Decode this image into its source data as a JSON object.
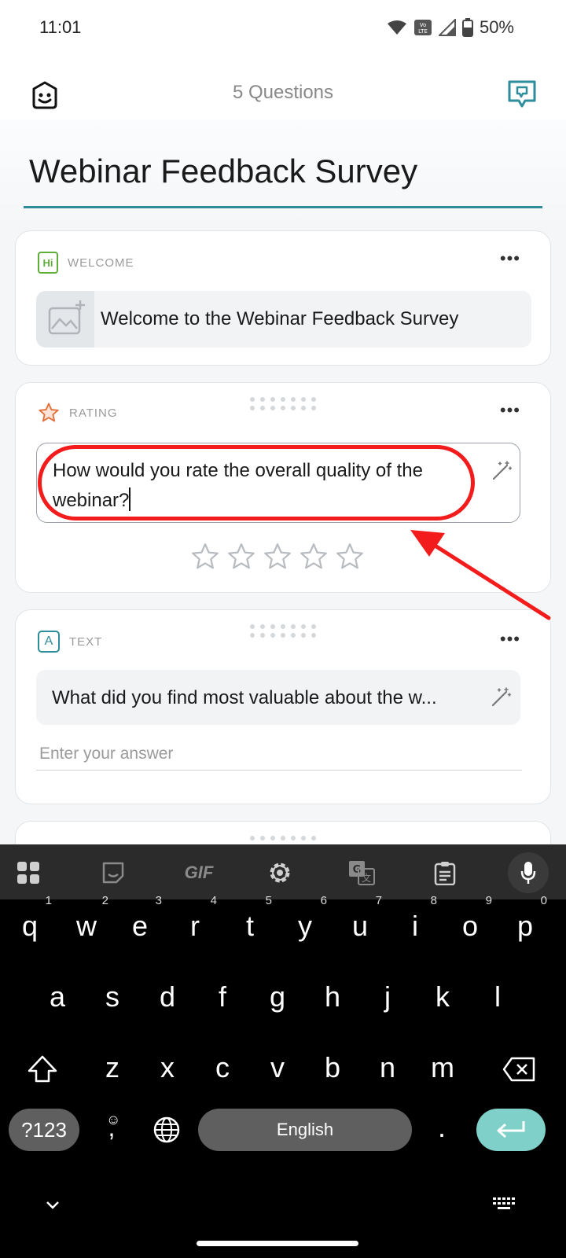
{
  "status_bar": {
    "time": "11:01",
    "battery": "50%"
  },
  "header": {
    "title": "5 Questions"
  },
  "survey": {
    "title": "Webinar Feedback Survey"
  },
  "cards": {
    "welcome": {
      "type_label": "WELCOME",
      "text": "Welcome to the Webinar Feedback Survey",
      "icon_text": "Hi"
    },
    "rating": {
      "type_label": "RATING",
      "question": "How would you rate the overall quality of the webinar?",
      "stars": 5
    },
    "text": {
      "type_label": "TEXT",
      "icon_text": "A",
      "question": "What did you find most valuable about the w...",
      "answer_placeholder": "Enter your answer"
    }
  },
  "keyboard": {
    "row1": [
      {
        "key": "q",
        "hint": "1"
      },
      {
        "key": "w",
        "hint": "2"
      },
      {
        "key": "e",
        "hint": "3"
      },
      {
        "key": "r",
        "hint": "4"
      },
      {
        "key": "t",
        "hint": "5"
      },
      {
        "key": "y",
        "hint": "6"
      },
      {
        "key": "u",
        "hint": "7"
      },
      {
        "key": "i",
        "hint": "8"
      },
      {
        "key": "o",
        "hint": "9"
      },
      {
        "key": "p",
        "hint": "0"
      }
    ],
    "row2": [
      "a",
      "s",
      "d",
      "f",
      "g",
      "h",
      "j",
      "k",
      "l"
    ],
    "row3": [
      "z",
      "x",
      "c",
      "v",
      "b",
      "n",
      "m"
    ],
    "symbols_label": "?123",
    "comma_label": ",",
    "space_label": "English",
    "period_label": ".",
    "gif_label": "GIF"
  },
  "colors": {
    "accent": "#2e8d9a",
    "annotation": "#f21c1c",
    "enter_key": "#7fd0c8",
    "keyboard_bg": "#000000"
  }
}
